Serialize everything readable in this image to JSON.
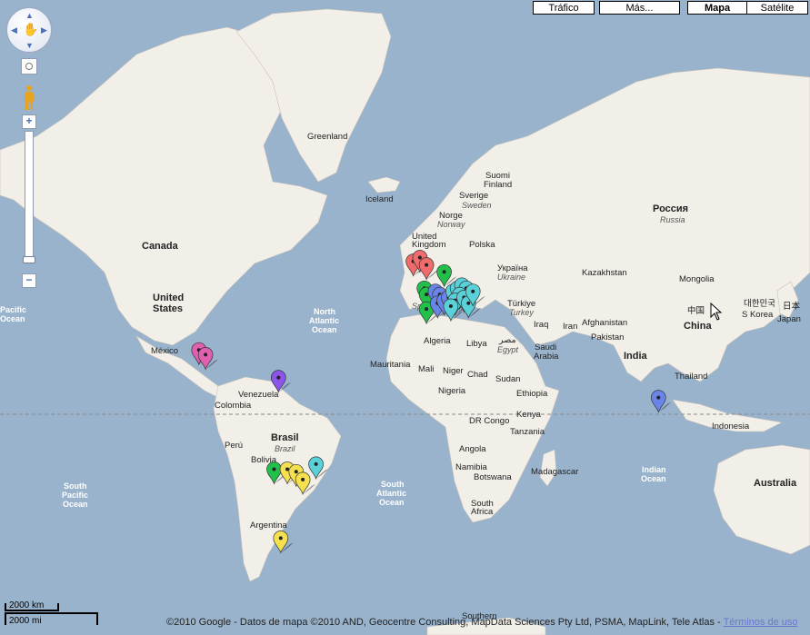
{
  "map_types": {
    "traffic": "Tráfico",
    "more": "Más...",
    "map": "Mapa",
    "satellite": "Satélite"
  },
  "controls": {
    "zoom_in": "+",
    "zoom_out": "−"
  },
  "scale": {
    "km": "2000 km",
    "mi": "2000 mi"
  },
  "copyright": "©2010 Google - Datos de mapa ©2010 AND, Geocentre Consulting, MapData Sciences Pty Ltd, PSMA, MapLink, Tele Atlas - ",
  "terms": "Términos de uso",
  "labels": {
    "greenland": "Greenland",
    "iceland": "Iceland",
    "canada": "Canada",
    "united": "United",
    "states": "States",
    "mexico": "México",
    "venezuela": "Venezuela",
    "colombia": "Colombia",
    "peru": "Perú",
    "brasil": "Brasil",
    "brazil_it": "Brazil",
    "bolivia": "Bolivia",
    "argentina": "Argentina",
    "suomi": "Suomi",
    "finland": "Finland",
    "sverige": "Sverige",
    "sweden": "Sweden",
    "norge": "Norge",
    "norway": "Norway",
    "united_k": "United",
    "kingdom": "Kingdom",
    "polska": "Polska",
    "ukraine_ua": "Україна",
    "ukraine": "Ukraine",
    "rossiya": "Россия",
    "russia": "Russia",
    "kazakhstan": "Kazakhstan",
    "mongolia": "Mongolia",
    "turkiye": "Türkiye",
    "turkey": "Turkey",
    "spain": "Spain",
    "iraq": "Iraq",
    "iran": "Iran",
    "afghanistan": "Afghanistan",
    "pakistan": "Pakistan",
    "india": "India",
    "china_cn": "中国",
    "china": "China",
    "korea_kr": "대한민국",
    "s_korea": "S Korea",
    "japan_jp": "日本",
    "japan": "Japan",
    "thailand": "Thailand",
    "indonesia": "Indonesia",
    "australia": "Australia",
    "algeria": "Algeria",
    "libya": "Libya",
    "egypt_ar": "مصر",
    "egypt": "Egypt",
    "saudi": "Saudi",
    "arabia": "Arabia",
    "mauritania": "Mauritania",
    "mali": "Mali",
    "niger": "Niger",
    "chad": "Chad",
    "sudan": "Sudan",
    "nigeria": "Nigeria",
    "ethiopia": "Ethiopia",
    "drcongo": "DR Congo",
    "kenya": "Kenya",
    "tanzania": "Tanzania",
    "angola": "Angola",
    "namibia": "Namibia",
    "botswana": "Botswana",
    "madagascar": "Madagascar",
    "south_africa_1": "South",
    "south_africa_2": "Africa",
    "north_atl_1": "North",
    "north_atl_2": "Atlantic",
    "north_atl_3": "Ocean",
    "south_atl_1": "South",
    "south_atl_2": "Atlantic",
    "south_atl_3": "Ocean",
    "south_pac_1": "South",
    "south_pac_2": "Pacific",
    "south_pac_3": "Ocean",
    "pacific_1": "Pacific",
    "pacific_2": "Ocean",
    "indian_1": "Indian",
    "indian_2": "Ocean",
    "southern": "Southern"
  },
  "markers": [
    {
      "color": "#f06b6b",
      "lon": -8,
      "lat": 53
    },
    {
      "color": "#f06b6b",
      "lon": -5,
      "lat": 54
    },
    {
      "color": "#f06b6b",
      "lon": -2,
      "lat": 52
    },
    {
      "color": "#22c04a",
      "lon": 6,
      "lat": 50
    },
    {
      "color": "#22c04a",
      "lon": -3,
      "lat": 45
    },
    {
      "color": "#22c04a",
      "lon": -2,
      "lat": 43
    },
    {
      "color": "#22c04a",
      "lon": -2,
      "lat": 38
    },
    {
      "color": "#6a85e8",
      "lon": 2,
      "lat": 44
    },
    {
      "color": "#6a85e8",
      "lon": 4,
      "lat": 43
    },
    {
      "color": "#6a85e8",
      "lon": 3,
      "lat": 40
    },
    {
      "color": "#6a85e8",
      "lon": 6,
      "lat": 41
    },
    {
      "color": "#6a85e8",
      "lon": 8,
      "lat": 42
    },
    {
      "color": "#5ad0d8",
      "lon": 10,
      "lat": 44
    },
    {
      "color": "#5ad0d8",
      "lon": 12,
      "lat": 45
    },
    {
      "color": "#5ad0d8",
      "lon": 14,
      "lat": 46
    },
    {
      "color": "#5ad0d8",
      "lon": 16,
      "lat": 45
    },
    {
      "color": "#5ad0d8",
      "lon": 13,
      "lat": 43
    },
    {
      "color": "#5ad0d8",
      "lon": 11,
      "lat": 41
    },
    {
      "color": "#5ad0d8",
      "lon": 15,
      "lat": 42
    },
    {
      "color": "#5ad0d8",
      "lon": 17,
      "lat": 40
    },
    {
      "color": "#5ad0d8",
      "lon": 19,
      "lat": 44
    },
    {
      "color": "#5ad0d8",
      "lon": 9,
      "lat": 39
    },
    {
      "color": "#e060b0",
      "lon": -105,
      "lat": 22
    },
    {
      "color": "#e060b0",
      "lon": -102,
      "lat": 20
    },
    {
      "color": "#8a55e8",
      "lon": -69,
      "lat": 10
    },
    {
      "color": "#6a85e8",
      "lon": 103,
      "lat": 1
    },
    {
      "color": "#22c04a",
      "lon": -71,
      "lat": -30
    },
    {
      "color": "#f5e050",
      "lon": -65,
      "lat": -30
    },
    {
      "color": "#f5e050",
      "lon": -61,
      "lat": -31
    },
    {
      "color": "#f5e050",
      "lon": -58,
      "lat": -34
    },
    {
      "color": "#5ad0d8",
      "lon": -52,
      "lat": -28
    },
    {
      "color": "#f5e050",
      "lon": -68,
      "lat": -53
    }
  ]
}
